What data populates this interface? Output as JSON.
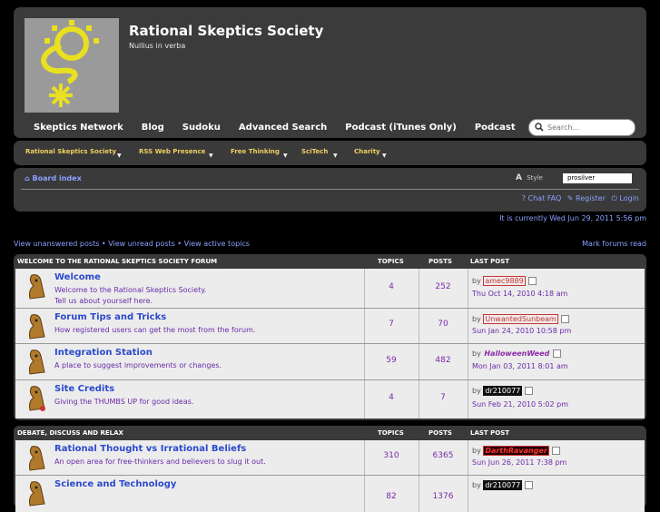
{
  "header": {
    "site_title": "Rational Skeptics Society",
    "site_description": "Nullius in verba",
    "nav": [
      "Skeptics Network",
      "Blog",
      "Sudoku",
      "Advanced Search",
      "Podcast (iTunes Only)",
      "Podcast"
    ],
    "search_placeholder": "Search…"
  },
  "menubar": {
    "items": [
      "Rational Skeptics Society",
      "RSS Web Presence",
      "Free Thinking",
      "SciTech",
      "Charity"
    ]
  },
  "breadcrumb": {
    "board_index": "Board index",
    "style_label": "Style",
    "style_value": "prosilver",
    "chat_faq": "Chat FAQ",
    "register": "Register",
    "login": "Login"
  },
  "current_time": "It is currently Wed Jun 29, 2011 5:56 pm",
  "quicklinks": {
    "unanswered": "View unanswered posts",
    "unread": "View unread posts",
    "active": "View active topics",
    "separator": "•",
    "mark_read": "Mark forums read"
  },
  "categories": [
    {
      "title": "WELCOME TO THE RATIONAL SKEPTICS SOCIETY FORUM",
      "col_topics": "TOPICS",
      "col_posts": "POSTS",
      "col_lastpost": "LAST POST",
      "forums": [
        {
          "title": "Welcome",
          "desc": [
            "Welcome to the Rational Skeptics Society.",
            "Tell us about yourself here."
          ],
          "topics": "4",
          "posts": "252",
          "by": "by",
          "user": "amec9889",
          "date": "Thu Oct 14, 2010 4:18 am"
        },
        {
          "title": "Forum Tips and Tricks",
          "desc": [
            "How registered users can get the most from the forum."
          ],
          "topics": "7",
          "posts": "70",
          "by": "by",
          "user": "UnwantedSunbeam",
          "date": "Sun Jan 24, 2010 10:58 pm"
        },
        {
          "title": "Integration Station",
          "desc": [
            "A place to suggest improvements or changes."
          ],
          "topics": "59",
          "posts": "482",
          "by": "by",
          "user": "HalloweenWeed",
          "date": "Mon Jan 03, 2011 8:01 am"
        },
        {
          "title": "Site Credits",
          "desc": [
            "Giving the THUMBS UP for good ideas."
          ],
          "topics": "4",
          "posts": "7",
          "by": "by",
          "user": "dr210077",
          "date": "Sun Feb 21, 2010 5:02 pm"
        }
      ]
    },
    {
      "title": "DEBATE, DISCUSS AND RELAX",
      "col_topics": "TOPICS",
      "col_posts": "POSTS",
      "col_lastpost": "LAST POST",
      "forums": [
        {
          "title": "Rational Thought vs Irrational Beliefs",
          "desc": [
            "An open area for free-thinkers and believers to slug it out."
          ],
          "topics": "310",
          "posts": "6365",
          "by": "by",
          "user": "DarthRavanger",
          "date": "Sun Jun 26, 2011 7:38 pm"
        },
        {
          "title": "Science and Technology",
          "desc": [
            ""
          ],
          "topics": "82",
          "posts": "1376",
          "by": "by",
          "user": "dr210077",
          "date": ""
        }
      ]
    }
  ],
  "colors": {
    "accent_link": "#8aa0ff",
    "forum_title": "#2a4acc",
    "logo_yellow": "#f0e020"
  }
}
